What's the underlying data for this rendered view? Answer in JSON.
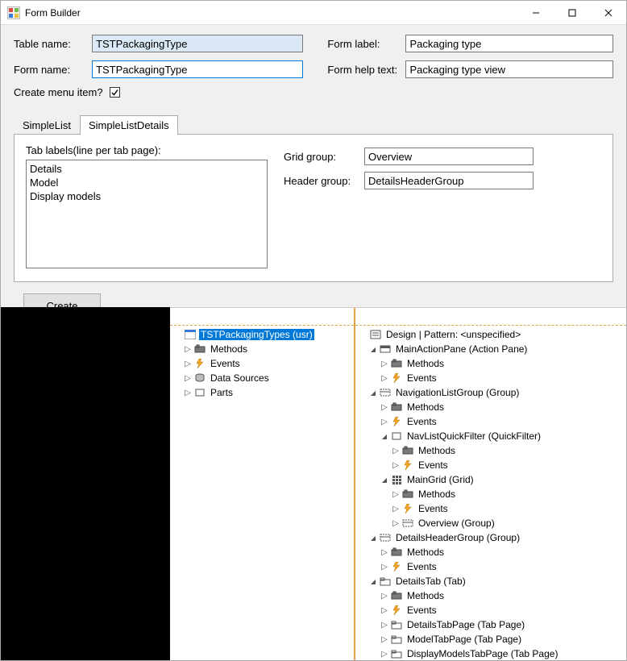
{
  "window": {
    "title": "Form Builder"
  },
  "form": {
    "table_name_label": "Table name:",
    "table_name_value": "TSTPackagingType",
    "form_name_label": "Form name:",
    "form_name_value": "TSTPackagingType",
    "form_label_label": "Form label:",
    "form_label_value": "Packaging type",
    "form_help_label": "Form help text:",
    "form_help_value": "Packaging type view",
    "create_menu_label": "Create menu item?",
    "create_menu_checked": true
  },
  "tabs": {
    "simple": "SimpleList",
    "details": "SimpleListDetails",
    "tab_labels_caption": "Tab labels(line per tab page):",
    "tab_labels_text": "Details\nModel\nDisplay models",
    "grid_group_label": "Grid group:",
    "grid_group_value": "Overview",
    "header_group_label": "Header group:",
    "header_group_value": "DetailsHeaderGroup"
  },
  "buttons": {
    "create": "Create"
  },
  "left_tree": {
    "root": "TSTPackagingTypes (usr)",
    "children": [
      "Methods",
      "Events",
      "Data Sources",
      "Parts"
    ]
  },
  "right_tree": {
    "design": "Design | Pattern: <unspecified>",
    "nodes": [
      {
        "l": 1,
        "exp": "▾",
        "icon": "pane",
        "t": "MainActionPane (Action Pane)"
      },
      {
        "l": 2,
        "exp": "▸",
        "icon": "methods",
        "t": "Methods"
      },
      {
        "l": 2,
        "exp": "▸",
        "icon": "events",
        "t": "Events"
      },
      {
        "l": 1,
        "exp": "▾",
        "icon": "group",
        "t": "NavigationListGroup (Group)"
      },
      {
        "l": 2,
        "exp": "▸",
        "icon": "methods",
        "t": "Methods"
      },
      {
        "l": 2,
        "exp": "▸",
        "icon": "events",
        "t": "Events"
      },
      {
        "l": 2,
        "exp": "▾",
        "icon": "box",
        "t": "NavListQuickFilter (QuickFilter)"
      },
      {
        "l": 3,
        "exp": "▸",
        "icon": "methods",
        "t": "Methods"
      },
      {
        "l": 3,
        "exp": "▸",
        "icon": "events",
        "t": "Events"
      },
      {
        "l": 2,
        "exp": "▾",
        "icon": "grid",
        "t": "MainGrid (Grid)"
      },
      {
        "l": 3,
        "exp": "▸",
        "icon": "methods",
        "t": "Methods"
      },
      {
        "l": 3,
        "exp": "▸",
        "icon": "events",
        "t": "Events"
      },
      {
        "l": 3,
        "exp": "▸",
        "icon": "group",
        "t": "Overview (Group)"
      },
      {
        "l": 1,
        "exp": "▾",
        "icon": "group",
        "t": "DetailsHeaderGroup (Group)"
      },
      {
        "l": 2,
        "exp": "▸",
        "icon": "methods",
        "t": "Methods"
      },
      {
        "l": 2,
        "exp": "▸",
        "icon": "events",
        "t": "Events"
      },
      {
        "l": 1,
        "exp": "▾",
        "icon": "tab",
        "t": "DetailsTab (Tab)"
      },
      {
        "l": 2,
        "exp": "▸",
        "icon": "methods",
        "t": "Methods"
      },
      {
        "l": 2,
        "exp": "▸",
        "icon": "events",
        "t": "Events"
      },
      {
        "l": 2,
        "exp": "▸",
        "icon": "tab",
        "t": "DetailsTabPage (Tab Page)"
      },
      {
        "l": 2,
        "exp": "▸",
        "icon": "tab",
        "t": "ModelTabPage (Tab Page)"
      },
      {
        "l": 2,
        "exp": "▸",
        "icon": "tab",
        "t": "DisplayModelsTabPage (Tab Page)"
      }
    ]
  }
}
